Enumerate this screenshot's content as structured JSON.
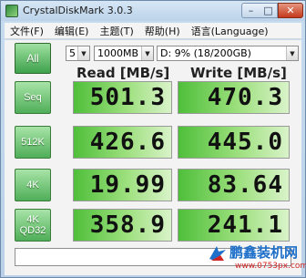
{
  "window": {
    "title": "CrystalDiskMark 3.0.3",
    "minimize": "–",
    "maximize": "□",
    "close": "✕"
  },
  "menu": [
    "文件(F)",
    "编辑(E)",
    "主题(T)",
    "帮助(H)",
    "语言(Language)"
  ],
  "controls": {
    "all_label": "All",
    "test_count": "5",
    "test_size": "1000MB",
    "drive": "D: 9% (18/200GB)",
    "dropdown_arrow": "▼"
  },
  "headers": {
    "read": "Read [MB/s]",
    "write": "Write [MB/s]"
  },
  "rows": [
    {
      "label_line1": "Seq",
      "label_line2": "",
      "read": "501.3",
      "write": "470.3"
    },
    {
      "label_line1": "512K",
      "label_line2": "",
      "read": "426.6",
      "write": "445.0"
    },
    {
      "label_line1": "4K",
      "label_line2": "",
      "read": "19.99",
      "write": "83.64"
    },
    {
      "label_line1": "4K",
      "label_line2": "QD32",
      "read": "358.9",
      "write": "241.1"
    }
  ],
  "comment": "",
  "watermark": {
    "name": "鹏鑫装机网",
    "url": "www.0753px.com"
  },
  "colors": {
    "accent_green": "#4fae58",
    "cell_green": "#9ee07f",
    "watermark_blue": "#1e6fc9",
    "watermark_red": "#d12424"
  },
  "icons": [
    "app-icon",
    "minimize-icon",
    "maximize-icon",
    "close-icon",
    "dropdown-arrow-icon",
    "watermark-logo-icon"
  ]
}
